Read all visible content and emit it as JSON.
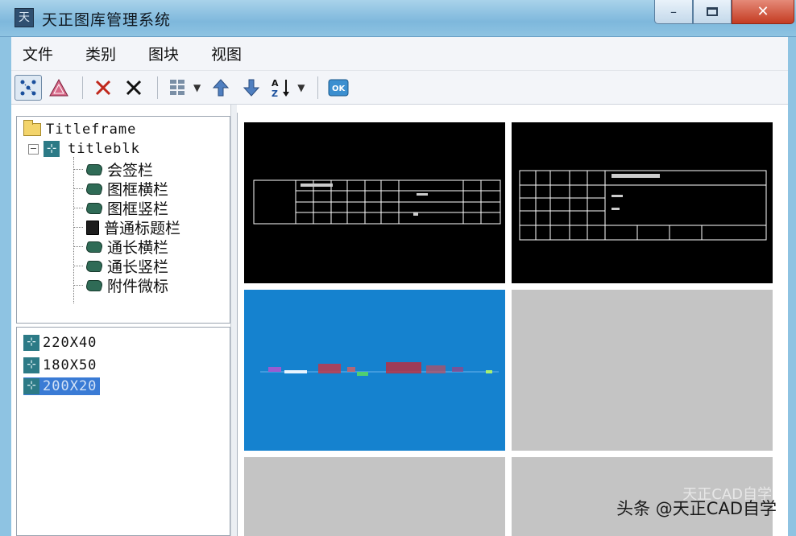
{
  "window": {
    "title": "天正图库管理系统",
    "app_icon": "tz-logo-icon",
    "controls": {
      "minimize": "–",
      "maximize": "□",
      "close": "✕"
    }
  },
  "menu": [
    "文件",
    "类别",
    "图块",
    "视图"
  ],
  "toolbar": {
    "buttons": [
      {
        "name": "select-mode-icon",
        "glyph": "⁘",
        "pressed": true
      },
      {
        "name": "triangle-view-icon",
        "glyph": "▲",
        "pressed": false
      },
      {
        "name": "delete-red-icon",
        "glyph": "✕",
        "color": "#c0281c"
      },
      {
        "name": "delete-black-icon",
        "glyph": "✕",
        "color": "#111111"
      },
      {
        "name": "view-layout-icon",
        "glyph": "▦"
      },
      {
        "name": "move-up-icon",
        "glyph": "⬆"
      },
      {
        "name": "move-down-icon",
        "glyph": "⬇"
      },
      {
        "name": "sort-az-icon",
        "glyph": "A↓"
      },
      {
        "name": "ok-icon",
        "glyph": "OK"
      }
    ]
  },
  "tree": {
    "root": "Titleframe",
    "node": "titleblk",
    "node_expander": "−",
    "children": [
      "会签栏",
      "图框横栏",
      "图框竖栏",
      "普通标题栏",
      "通长横栏",
      "通长竖栏",
      "附件微标"
    ]
  },
  "blocks": {
    "items": [
      "220X40",
      "180X50",
      "200X20"
    ],
    "selected_index": 2
  },
  "watermark": {
    "text": "头条 @天正CAD自学",
    "ghost": "天正CAD自学"
  },
  "colors": {
    "titlebar": "#8ec3e2",
    "preview_black": "#000000",
    "preview_blue": "#1582cf",
    "preview_gray": "#c4c4c4",
    "selection": "#3a7bd5"
  }
}
